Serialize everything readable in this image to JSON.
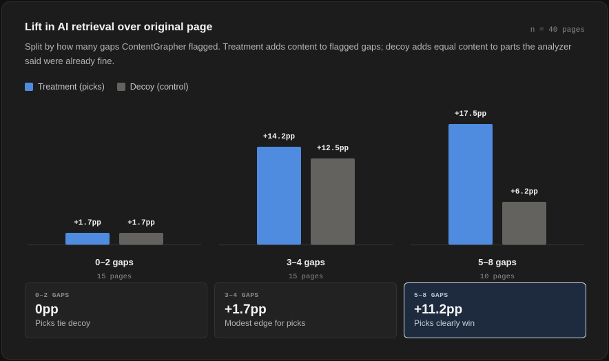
{
  "header": {
    "title": "Lift in AI retrieval over original page",
    "count": "n = 40 pages",
    "subtitle": "Split by how many gaps ContentGrapher flagged. Treatment adds content to flagged gaps; decoy adds equal content to parts the analyzer said were already fine."
  },
  "legend": [
    {
      "label": "Treatment (picks)",
      "color": "#4f8bde"
    },
    {
      "label": "Decoy (control)",
      "color": "#64625e"
    }
  ],
  "chart_data": {
    "type": "bar",
    "title": "Lift in AI retrieval over original page",
    "categories": [
      "0–2 gaps",
      "3–4 gaps",
      "5–8 gaps"
    ],
    "category_subs": [
      "15 pages",
      "15 pages",
      "10 pages"
    ],
    "series": [
      {
        "name": "Treatment (picks)",
        "color": "#4f8bde",
        "values": [
          1.7,
          14.2,
          17.5
        ],
        "labels": [
          "+1.7pp",
          "+14.2pp",
          "+17.5pp"
        ]
      },
      {
        "name": "Decoy (control)",
        "color": "#64625e",
        "values": [
          1.7,
          12.5,
          6.2
        ],
        "labels": [
          "+1.7pp",
          "+12.5pp",
          "+6.2pp"
        ]
      }
    ],
    "ylim": [
      0,
      20
    ],
    "grid": false,
    "legend_position": "top-left"
  },
  "summaries": [
    {
      "tag": "0–2 GAPS",
      "value": "0pp",
      "caption": "Picks tie decoy",
      "highlight": false
    },
    {
      "tag": "3–4 GAPS",
      "value": "+1.7pp",
      "caption": "Modest edge for picks",
      "highlight": false
    },
    {
      "tag": "5–8 GAPS",
      "value": "+11.2pp",
      "caption": "Picks clearly win",
      "highlight": true
    }
  ]
}
